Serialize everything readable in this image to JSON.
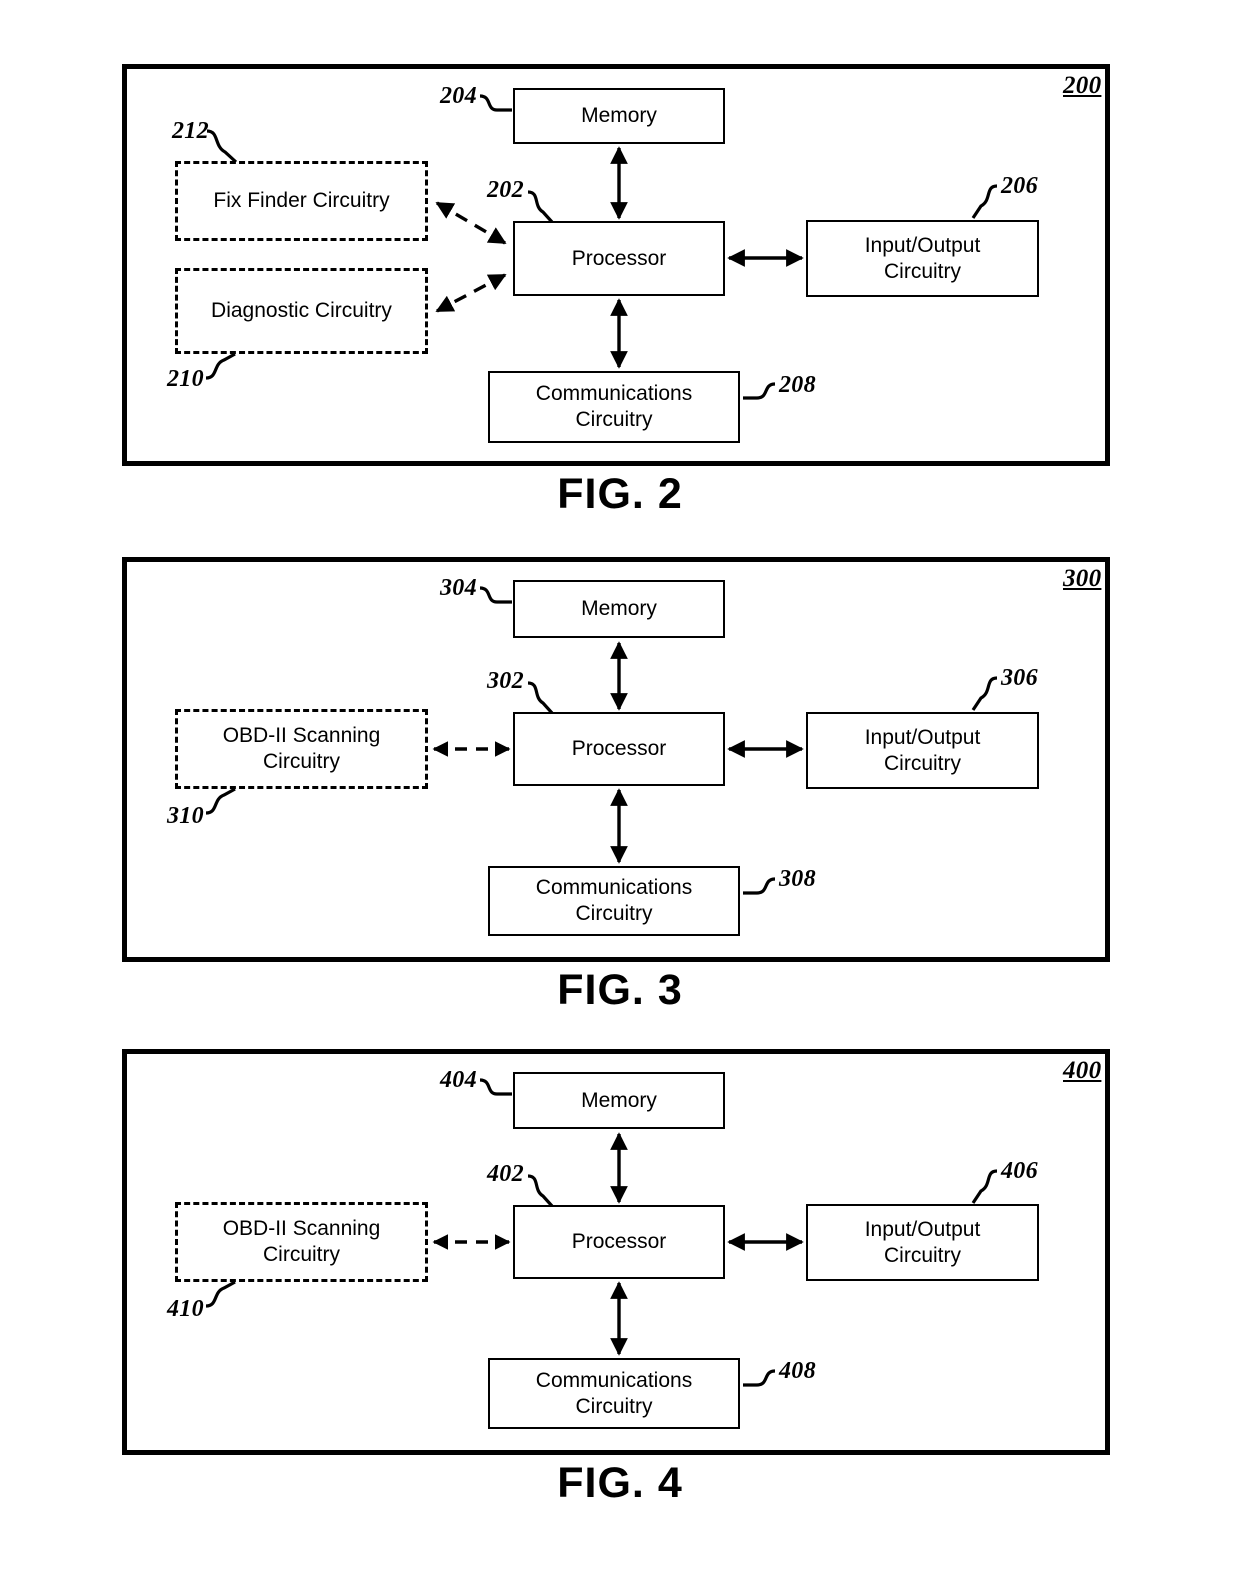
{
  "document": {
    "type": "patent-drawing-sheet",
    "figure_count": 3
  },
  "figures": [
    {
      "id": "fig2",
      "caption": "FIG. 2",
      "frame_ref": "200",
      "blocks": [
        {
          "name": "memory",
          "label": "Memory",
          "ref": "204",
          "style": "solid"
        },
        {
          "name": "processor",
          "label": "Processor",
          "ref": "202",
          "style": "solid"
        },
        {
          "name": "io",
          "label": "Input/Output\nCircuitry",
          "ref": "206",
          "style": "solid"
        },
        {
          "name": "comms",
          "label": "Communications\nCircuitry",
          "ref": "208",
          "style": "solid"
        },
        {
          "name": "fix-finder",
          "label": "Fix Finder Circuitry",
          "ref": "212",
          "style": "dashed"
        },
        {
          "name": "diagnostic",
          "label": "Diagnostic Circuitry",
          "ref": "210",
          "style": "dashed"
        }
      ],
      "block_labels": {
        "memory": "Memory",
        "processor": "Processor",
        "io_line1": "Input/Output",
        "io_line2": "Circuitry",
        "comms_line1": "Communications",
        "comms_line2": "Circuitry",
        "fix_finder": "Fix Finder Circuitry",
        "diagnostic": "Diagnostic Circuitry"
      },
      "refs": {
        "frame": "200",
        "processor": "202",
        "memory": "204",
        "io": "206",
        "comms": "208",
        "diagnostic": "210",
        "fix_finder": "212"
      },
      "connections": [
        {
          "from": "processor",
          "to": "memory",
          "style": "solid",
          "arrows": "both"
        },
        {
          "from": "processor",
          "to": "io",
          "style": "solid",
          "arrows": "both"
        },
        {
          "from": "processor",
          "to": "comms",
          "style": "solid",
          "arrows": "both"
        },
        {
          "from": "processor",
          "to": "fix-finder",
          "style": "dashed",
          "arrows": "both"
        },
        {
          "from": "processor",
          "to": "diagnostic",
          "style": "dashed",
          "arrows": "both"
        }
      ]
    },
    {
      "id": "fig3",
      "caption": "FIG. 3",
      "frame_ref": "300",
      "blocks": [
        {
          "name": "memory",
          "label": "Memory",
          "ref": "304",
          "style": "solid"
        },
        {
          "name": "processor",
          "label": "Processor",
          "ref": "302",
          "style": "solid"
        },
        {
          "name": "io",
          "label": "Input/Output\nCircuitry",
          "ref": "306",
          "style": "solid"
        },
        {
          "name": "comms",
          "label": "Communications\nCircuitry",
          "ref": "308",
          "style": "solid"
        },
        {
          "name": "obd",
          "label": "OBD-II Scanning\nCircuitry",
          "ref": "310",
          "style": "dashed"
        }
      ],
      "block_labels": {
        "memory": "Memory",
        "processor": "Processor",
        "io_line1": "Input/Output",
        "io_line2": "Circuitry",
        "comms_line1": "Communications",
        "comms_line2": "Circuitry",
        "obd_line1": "OBD-II Scanning",
        "obd_line2": "Circuitry"
      },
      "refs": {
        "frame": "300",
        "processor": "302",
        "memory": "304",
        "io": "306",
        "comms": "308",
        "obd": "310"
      },
      "connections": [
        {
          "from": "processor",
          "to": "memory",
          "style": "solid",
          "arrows": "both"
        },
        {
          "from": "processor",
          "to": "io",
          "style": "solid",
          "arrows": "both"
        },
        {
          "from": "processor",
          "to": "comms",
          "style": "solid",
          "arrows": "both"
        },
        {
          "from": "processor",
          "to": "obd",
          "style": "dashed",
          "arrows": "both"
        }
      ]
    },
    {
      "id": "fig4",
      "caption": "FIG. 4",
      "frame_ref": "400",
      "blocks": [
        {
          "name": "memory",
          "label": "Memory",
          "ref": "404",
          "style": "solid"
        },
        {
          "name": "processor",
          "label": "Processor",
          "ref": "402",
          "style": "solid"
        },
        {
          "name": "io",
          "label": "Input/Output\nCircuitry",
          "ref": "406",
          "style": "solid"
        },
        {
          "name": "comms",
          "label": "Communications\nCircuitry",
          "ref": "408",
          "style": "solid"
        },
        {
          "name": "obd",
          "label": "OBD-II Scanning\nCircuitry",
          "ref": "410",
          "style": "dashed"
        }
      ],
      "block_labels": {
        "memory": "Memory",
        "processor": "Processor",
        "io_line1": "Input/Output",
        "io_line2": "Circuitry",
        "comms_line1": "Communications",
        "comms_line2": "Circuitry",
        "obd_line1": "OBD-II Scanning",
        "obd_line2": "Circuitry"
      },
      "refs": {
        "frame": "400",
        "processor": "402",
        "memory": "404",
        "io": "406",
        "comms": "408",
        "obd": "410"
      },
      "connections": [
        {
          "from": "processor",
          "to": "memory",
          "style": "solid",
          "arrows": "both"
        },
        {
          "from": "processor",
          "to": "io",
          "style": "solid",
          "arrows": "both"
        },
        {
          "from": "processor",
          "to": "comms",
          "style": "solid",
          "arrows": "both"
        },
        {
          "from": "processor",
          "to": "obd",
          "style": "dashed",
          "arrows": "both"
        }
      ]
    }
  ],
  "colors": {
    "ink": "#000000",
    "paper": "#ffffff"
  }
}
